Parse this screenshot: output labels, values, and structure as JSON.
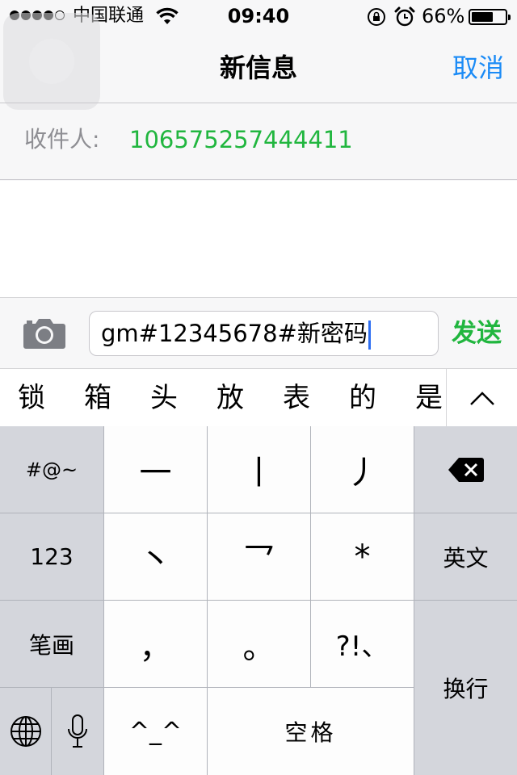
{
  "status_bar": {
    "carrier": "中国联通",
    "time": "09:40",
    "battery_percent": "66%",
    "battery_level": 0.66
  },
  "nav": {
    "title": "新信息",
    "cancel_label": "取消"
  },
  "recipient": {
    "label": "收件人:",
    "number": "106575257444411"
  },
  "compose": {
    "text": "gm#12345678#新密码",
    "send_label": "发送"
  },
  "candidates": [
    "锁",
    "箱",
    "头",
    "放",
    "表",
    "的",
    "是"
  ],
  "keyboard": {
    "row1": {
      "symbols": "#@~",
      "k1": "一",
      "k2": "丨",
      "k3": "丿"
    },
    "row2": {
      "numbers": "123",
      "k1": "丶",
      "k2": "乛",
      "k3": "*",
      "english": "英文"
    },
    "row3": {
      "stroke": "笔画",
      "k1": "，",
      "k2": "。",
      "k3": "?!、"
    },
    "row4": {
      "emoticon": "^_^",
      "space": "空格"
    },
    "return_label": "换行"
  },
  "colors": {
    "accent_blue": "#1b8bf6",
    "accent_green": "#21b63f",
    "caret": "#2e6ff2"
  }
}
